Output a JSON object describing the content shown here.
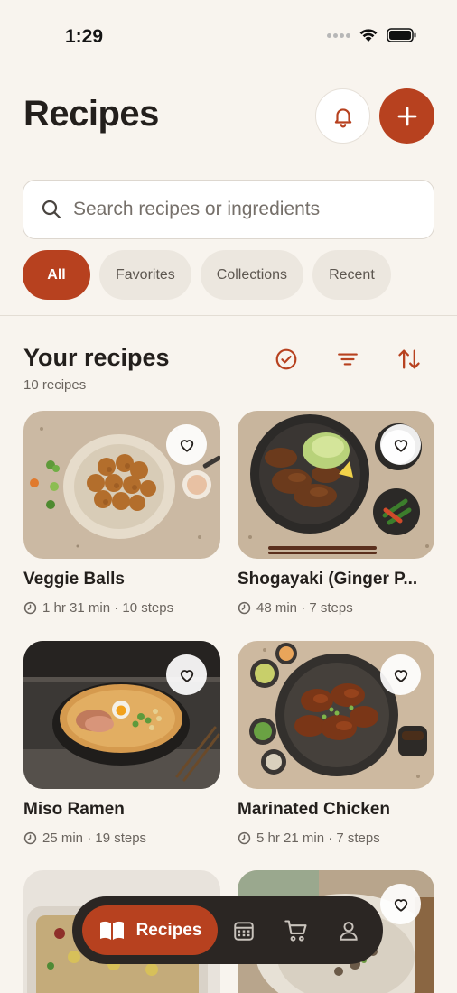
{
  "status_bar": {
    "time": "1:29"
  },
  "header": {
    "title": "Recipes"
  },
  "search": {
    "placeholder": "Search recipes or ingredients",
    "value": ""
  },
  "filters": [
    {
      "label": "All",
      "active": true
    },
    {
      "label": "Favorites",
      "active": false
    },
    {
      "label": "Collections",
      "active": false
    },
    {
      "label": "Recent",
      "active": false
    }
  ],
  "section": {
    "title": "Your recipes",
    "count": "10 recipes"
  },
  "recipes": [
    {
      "title": "Veggie Balls",
      "meta": "1 hr 31 min · 10 steps"
    },
    {
      "title": "Shogayaki (Ginger P...",
      "meta": "48 min · 7 steps"
    },
    {
      "title": "Miso Ramen",
      "meta": "25 min · 19 steps"
    },
    {
      "title": "Marinated Chicken",
      "meta": "5 hr 21 min · 7 steps"
    }
  ],
  "tabbar": {
    "active_label": "Recipes"
  },
  "colors": {
    "accent": "#b7411f",
    "background": "#f8f4ee",
    "tabbar": "#2b2623"
  },
  "icons": [
    "bell-icon",
    "plus-icon",
    "search-icon",
    "check-circle-icon",
    "filter-icon",
    "sort-icon",
    "heart-icon",
    "clock-icon",
    "book-icon",
    "calendar-icon",
    "cart-icon",
    "user-icon"
  ]
}
